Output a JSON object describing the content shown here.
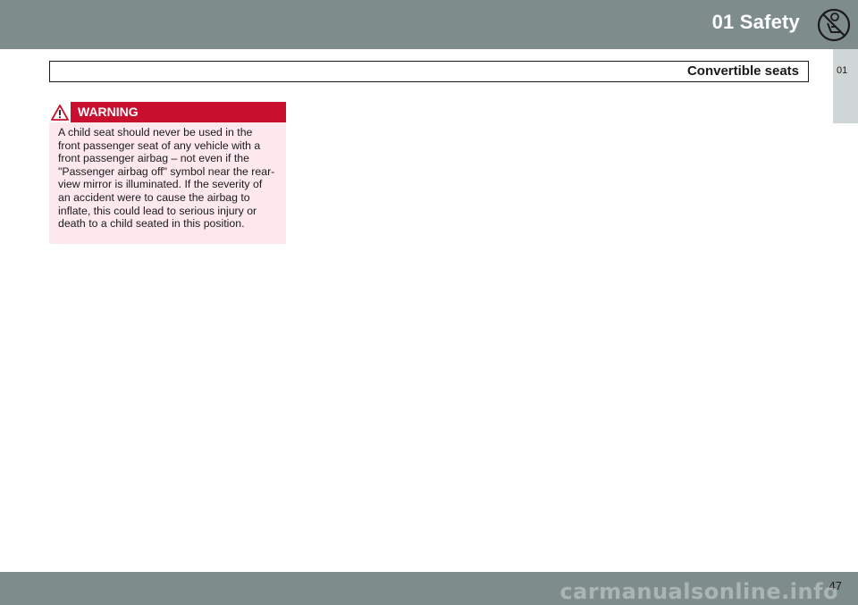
{
  "header": {
    "chapter_title": "01 Safety",
    "icon": "child-seat-airbag-icon"
  },
  "side_tab": {
    "label": "01"
  },
  "section": {
    "title": "Convertible seats"
  },
  "warning": {
    "label": "WARNING",
    "icon": "warning-triangle-icon",
    "text": "A child seat should never be used in the front passenger seat of any vehicle with a front passenger airbag – not even if the \"Passenger airbag off\" symbol near the rear-view mirror is illuminated. If the severity of an accident were to cause the airbag to inflate, this could lead to serious injury or death to a child seated in this position."
  },
  "footer": {
    "page_number": "47",
    "watermark": "carmanualsonline.info"
  },
  "colors": {
    "bar": "#7e8d8c",
    "tab": "#cfd6d5",
    "warning_red": "#c8102e",
    "warning_bg": "#fde8ee"
  }
}
